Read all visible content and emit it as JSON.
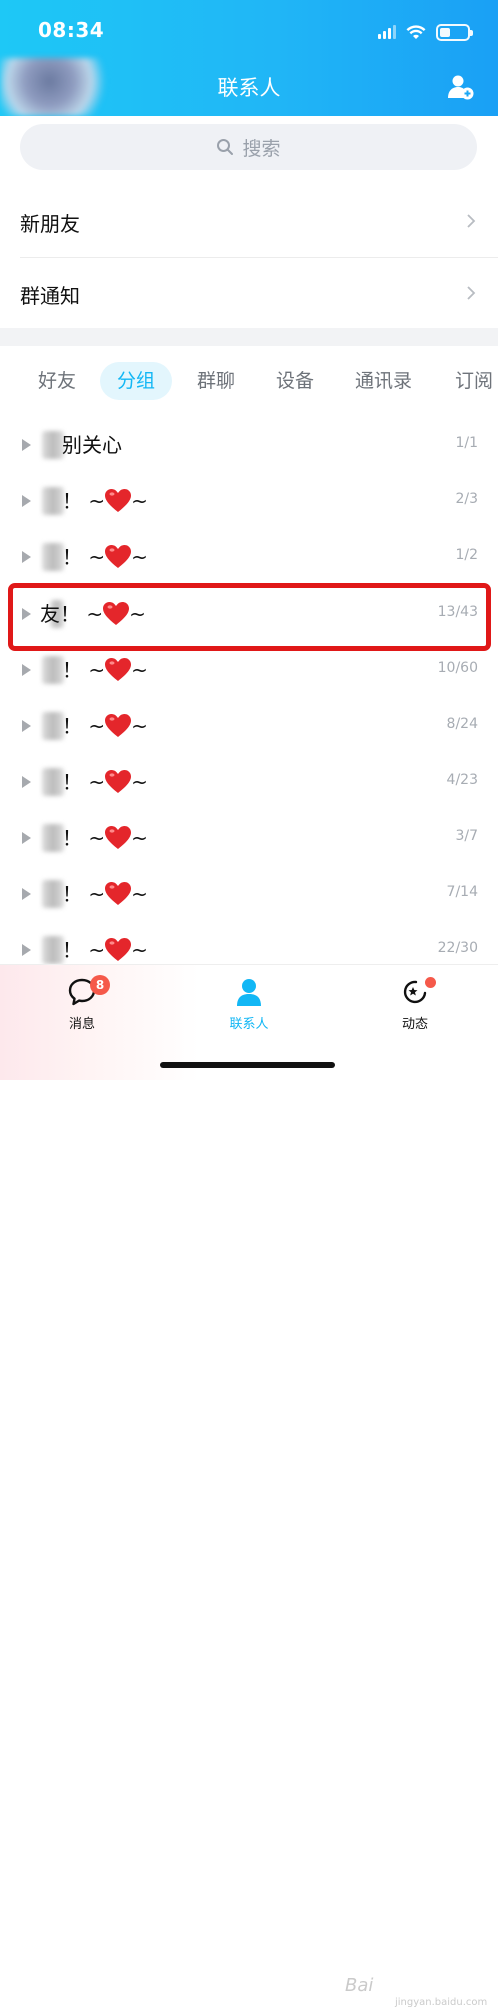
{
  "status_bar": {
    "time": "08:34"
  },
  "header": {
    "title": "联系人"
  },
  "search": {
    "placeholder": "搜索"
  },
  "menu": [
    {
      "label": "新朋友"
    },
    {
      "label": "群通知"
    }
  ],
  "tabs": [
    {
      "label": "好友",
      "active": false
    },
    {
      "label": "分组",
      "active": true
    },
    {
      "label": "群聊",
      "active": false
    },
    {
      "label": "设备",
      "active": false
    },
    {
      "label": "通讯录",
      "active": false
    },
    {
      "label": "订阅",
      "active": false
    }
  ],
  "groups": [
    {
      "name": "别关心",
      "count": "1/1"
    },
    {
      "name": "！ ~",
      "suffix": "~",
      "count": "2/3"
    },
    {
      "name": "！ ~",
      "suffix": "~",
      "count": "1/2"
    },
    {
      "prefix": "友",
      "name": "！ ~",
      "suffix": "~",
      "count": "13/43"
    },
    {
      "name": "！ ~",
      "suffix": "~",
      "count": "10/60"
    },
    {
      "name": "！ ~",
      "suffix": "~",
      "count": "8/24"
    },
    {
      "name": "！ ~",
      "suffix": "~",
      "count": "4/23"
    },
    {
      "name": "！ ~",
      "suffix": "~",
      "count": "3/7"
    },
    {
      "name": "！ ~",
      "suffix": "~",
      "count": "7/14"
    },
    {
      "name": "！ ~",
      "suffix": "~",
      "count": "22/30"
    }
  ],
  "tabbar": [
    {
      "label": "消息",
      "badge": "8",
      "icon": "chat-bubble-icon",
      "active": false
    },
    {
      "label": "联系人",
      "icon": "contacts-person-icon",
      "active": true
    },
    {
      "label": "动态",
      "icon": "star-refresh-icon",
      "active": false
    }
  ],
  "watermark": {
    "text": "Bai",
    "sub": "jingyan.baidu.com"
  },
  "colors": {
    "accent": "#12b7f5",
    "highlight_box": "#e01818",
    "badge": "#f5594a"
  }
}
